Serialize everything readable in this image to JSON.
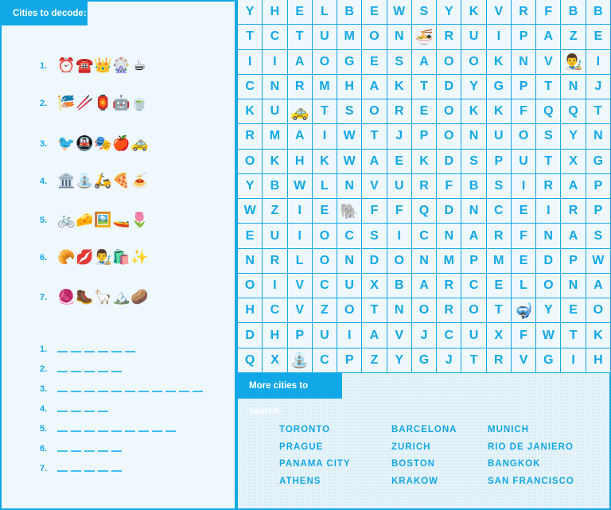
{
  "decode_panel": {
    "title": "Cities to decode:",
    "rebuses": [
      {
        "number": "1.",
        "emojis": [
          "⏰",
          "☎️",
          "👑",
          "🎡",
          "☕"
        ]
      },
      {
        "number": "2.",
        "emojis": [
          "🎏",
          "🥢",
          "🏮",
          "🤖",
          "🍵"
        ]
      },
      {
        "number": "3.",
        "emojis": [
          "🐦",
          "🚇",
          "🎭",
          "🍎",
          "🚕"
        ]
      },
      {
        "number": "4.",
        "emojis": [
          "🏛️",
          "⛲",
          "🛵",
          "🍕",
          "🍝"
        ]
      },
      {
        "number": "5.",
        "emojis": [
          "🚲",
          "🧀",
          "🖼️",
          "🚤",
          "🌷"
        ]
      },
      {
        "number": "6.",
        "emojis": [
          "🥐",
          "💋",
          "👨‍🎨",
          "🛍️",
          "✨"
        ]
      },
      {
        "number": "7.",
        "emojis": [
          "🧶",
          "🥾",
          "🦙",
          "🏔️",
          "🥔"
        ]
      }
    ],
    "answers": [
      {
        "number": "1.",
        "letters": 6
      },
      {
        "number": "2.",
        "letters": 5
      },
      {
        "number": "3.",
        "letters": 11
      },
      {
        "number": "4.",
        "letters": 4
      },
      {
        "number": "5.",
        "letters": 9
      },
      {
        "number": "6.",
        "letters": 5
      },
      {
        "number": "7.",
        "letters": 5
      }
    ]
  },
  "word_search": {
    "rows": [
      [
        "Y",
        "H",
        "E",
        "L",
        "B",
        "E",
        "W",
        "S",
        "Y",
        "K",
        "V",
        "R",
        "F",
        "B",
        "B"
      ],
      [
        "T",
        "C",
        "T",
        "U",
        "M",
        "O",
        "N",
        "🍜",
        "R",
        "U",
        "I",
        "P",
        "A",
        "Z",
        "E"
      ],
      [
        "I",
        "I",
        "A",
        "O",
        "G",
        "E",
        "S",
        "A",
        "O",
        "O",
        "K",
        "N",
        "V",
        "👨‍🎨",
        "I"
      ],
      [
        "C",
        "N",
        "R",
        "M",
        "H",
        "A",
        "K",
        "T",
        "D",
        "Y",
        "G",
        "P",
        "T",
        "N",
        "J"
      ],
      [
        "K",
        "U",
        "🚕",
        "T",
        "S",
        "O",
        "R",
        "E",
        "O",
        "K",
        "K",
        "F",
        "Q",
        "Q",
        "T"
      ],
      [
        "R",
        "M",
        "A",
        "I",
        "W",
        "T",
        "J",
        "P",
        "O",
        "N",
        "U",
        "O",
        "S",
        "Y",
        "N"
      ],
      [
        "O",
        "K",
        "H",
        "K",
        "W",
        "A",
        "E",
        "K",
        "D",
        "S",
        "P",
        "U",
        "T",
        "X",
        "G"
      ],
      [
        "Y",
        "B",
        "W",
        "L",
        "N",
        "V",
        "U",
        "R",
        "F",
        "B",
        "S",
        "I",
        "R",
        "A",
        "P"
      ],
      [
        "W",
        "Z",
        "I",
        "E",
        "🐘",
        "F",
        "F",
        "Q",
        "D",
        "N",
        "C",
        "E",
        "I",
        "R",
        "P"
      ],
      [
        "E",
        "U",
        "I",
        "O",
        "C",
        "S",
        "I",
        "C",
        "N",
        "A",
        "R",
        "F",
        "N",
        "A",
        "S"
      ],
      [
        "N",
        "R",
        "L",
        "O",
        "N",
        "D",
        "O",
        "N",
        "M",
        "P",
        "M",
        "E",
        "D",
        "P",
        "W"
      ],
      [
        "O",
        "I",
        "V",
        "C",
        "U",
        "X",
        "B",
        "A",
        "R",
        "C",
        "E",
        "L",
        "O",
        "N",
        "A"
      ],
      [
        "H",
        "C",
        "V",
        "Z",
        "O",
        "T",
        "N",
        "O",
        "R",
        "O",
        "T",
        "🤿",
        "Y",
        "E",
        "O"
      ],
      [
        "D",
        "H",
        "P",
        "U",
        "I",
        "A",
        "V",
        "J",
        "C",
        "U",
        "X",
        "F",
        "W",
        "T",
        "K"
      ],
      [
        "Q",
        "X",
        "⛲",
        "C",
        "P",
        "Z",
        "Y",
        "G",
        "J",
        "T",
        "R",
        "V",
        "G",
        "I",
        "H"
      ]
    ]
  },
  "search_panel": {
    "title": "More cities to search:",
    "columns": [
      [
        "TORONTO",
        "PRAGUE",
        "PANAMA CITY",
        "ATHENS"
      ],
      [
        "BARCELONA",
        "ZURICH",
        "BOSTON",
        "KRAKOW"
      ],
      [
        "MUNICH",
        "RIO DE JANIERO",
        "BANGKOK",
        "SAN FRANCISCO"
      ]
    ]
  }
}
